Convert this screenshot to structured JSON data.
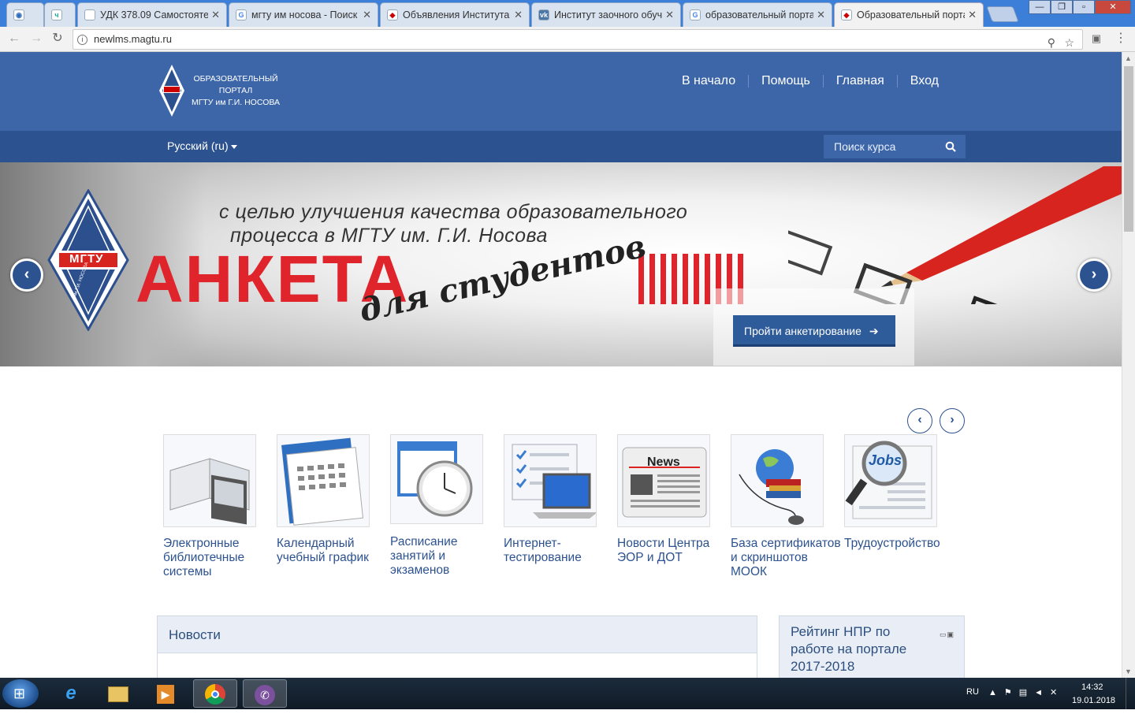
{
  "browser": {
    "tabs": [
      {
        "title": "",
        "icon": "eye-icon"
      },
      {
        "title": "",
        "icon": "app-icon"
      },
      {
        "title": "УДК 378.09 Самостояте",
        "icon": "document-icon"
      },
      {
        "title": "мгту им носова - Поиск",
        "icon": "google-icon"
      },
      {
        "title": "Объявления Института",
        "icon": "mgtu-icon"
      },
      {
        "title": "Институт заочного обуч",
        "icon": "vk-icon"
      },
      {
        "title": "образовательный порта",
        "icon": "google-icon"
      },
      {
        "title": "Образовательный порта",
        "icon": "mgtu-icon",
        "active": true
      }
    ],
    "url": "newlms.magtu.ru"
  },
  "header": {
    "logo_lines": [
      "ОБРАЗОВАТЕЛЬНЫЙ",
      "ПОРТАЛ",
      "МГТУ им Г.И. НОСОВА"
    ],
    "nav": [
      "В начало",
      "Помощь",
      "Главная",
      "Вход"
    ]
  },
  "subbar": {
    "language": "Русский (ru)",
    "search_placeholder": "Поиск курса"
  },
  "slider": {
    "line1": "с целью улучшения качества образовательного",
    "line2": "процесса в МГТУ им. Г.И. Носова",
    "big": "АНКЕТА",
    "script": "для студентов",
    "cta": "Пройти анкетирование",
    "logo_text": "МГТУ",
    "logo_sub": "им Г.И. НОСОВА"
  },
  "tiles": [
    {
      "label": "Электронные библиотечные системы",
      "icon": "ebook-icon"
    },
    {
      "label": "Календарный учебный график",
      "icon": "calendar-icon"
    },
    {
      "label": "Расписание занятий и экзаменов",
      "icon": "schedule-clock-icon"
    },
    {
      "label": "Интернет-тестирование",
      "icon": "laptop-checklist-icon"
    },
    {
      "label": "Новости Центра ЭОР и ДОТ",
      "icon": "newspaper-icon",
      "img_text": "News"
    },
    {
      "label": "База сертификатов и скриншотов МООК",
      "icon": "globe-books-icon"
    },
    {
      "label": "Трудоустройство",
      "icon": "jobs-magnifier-icon",
      "img_text": "Jobs"
    }
  ],
  "blocks": {
    "news_title": "Новости",
    "rating_title": "Рейтинг НПР по работе на портале 2017-2018"
  },
  "taskbar": {
    "lang": "RU",
    "time": "14:32",
    "date": "19.01.2018"
  },
  "colors": {
    "header": "#3d66a8",
    "subbar": "#2c5290",
    "accent_red": "#e0242b",
    "link": "#2c5290"
  }
}
